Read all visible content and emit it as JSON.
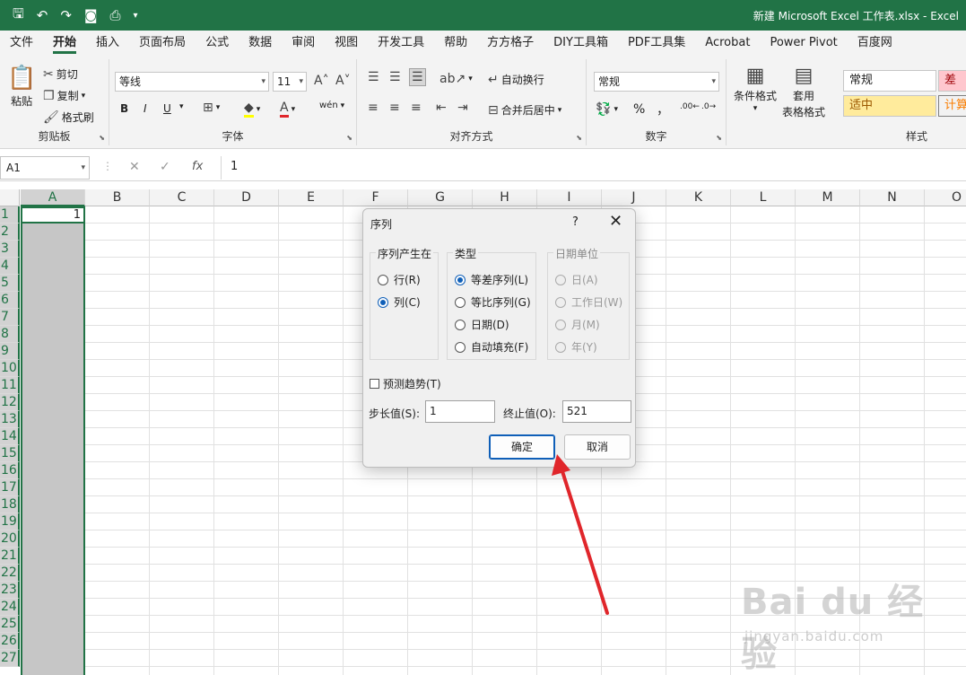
{
  "titlebar": {
    "document_title": "新建 Microsoft Excel 工作表.xlsx - Excel",
    "quick_access": [
      "save-icon",
      "undo-icon",
      "redo-icon",
      "camera-icon",
      "print-preview-icon",
      "customize-icon"
    ]
  },
  "tabs": [
    "文件",
    "开始",
    "插入",
    "页面布局",
    "公式",
    "数据",
    "审阅",
    "视图",
    "开发工具",
    "帮助",
    "方方格子",
    "DIY工具箱",
    "PDF工具集",
    "Acrobat",
    "Power Pivot",
    "百度网"
  ],
  "active_tab": "开始",
  "ribbon": {
    "clipboard": {
      "paste": "粘贴",
      "cut": "剪切",
      "copy": "复制",
      "format_painter": "格式刷",
      "label": "剪贴板"
    },
    "font": {
      "name": "等线",
      "size": "11",
      "bold": "B",
      "italic": "I",
      "underline": "U",
      "wen": "wén",
      "label": "字体"
    },
    "alignment": {
      "wrap": "自动换行",
      "merge": "合并后居中",
      "label": "对齐方式"
    },
    "number": {
      "format": "常规",
      "percent": "%",
      "comma": "，",
      "label": "数字"
    },
    "styles": {
      "conditional": "条件格式",
      "table_line1": "套用",
      "table_line2": "表格格式",
      "normal": "常规",
      "bad": "差",
      "neutral": "适中",
      "calc": "计算",
      "label": "样式"
    }
  },
  "formula_bar": {
    "name_box": "A1",
    "content": "1",
    "fx": "fx"
  },
  "grid": {
    "columns": [
      "A",
      "B",
      "C",
      "D",
      "E",
      "F",
      "G",
      "H",
      "I",
      "J",
      "K",
      "L",
      "M",
      "N",
      "O"
    ],
    "rows": [
      "1",
      "2",
      "3",
      "4",
      "5",
      "6",
      "7",
      "8",
      "9",
      "10",
      "11",
      "12",
      "13",
      "14",
      "15",
      "16",
      "17",
      "18",
      "19",
      "20",
      "21",
      "22",
      "23",
      "24",
      "25",
      "26",
      "27"
    ],
    "a1_value": "1"
  },
  "dialog": {
    "title": "序列",
    "help": "?",
    "series_in": {
      "legend": "序列产生在",
      "rows": "行(R)",
      "columns": "列(C)"
    },
    "type": {
      "legend": "类型",
      "linear": "等差序列(L)",
      "growth": "等比序列(G)",
      "date": "日期(D)",
      "autofill": "自动填充(F)"
    },
    "date_unit": {
      "legend": "日期单位",
      "day": "日(A)",
      "weekday": "工作日(W)",
      "month": "月(M)",
      "year": "年(Y)"
    },
    "trend": "预测趋势(T)",
    "step_label": "步长值(S):",
    "step_value": "1",
    "stop_label": "终止值(O):",
    "stop_value": "521",
    "ok": "确定",
    "cancel": "取消"
  },
  "watermark": {
    "brand": "Bai du 经验",
    "url": "jingyan.baidu.com"
  },
  "colors": {
    "excel_green": "#217346",
    "annotation_red": "#e0262b",
    "selected_blue": "#0f5fb8"
  }
}
